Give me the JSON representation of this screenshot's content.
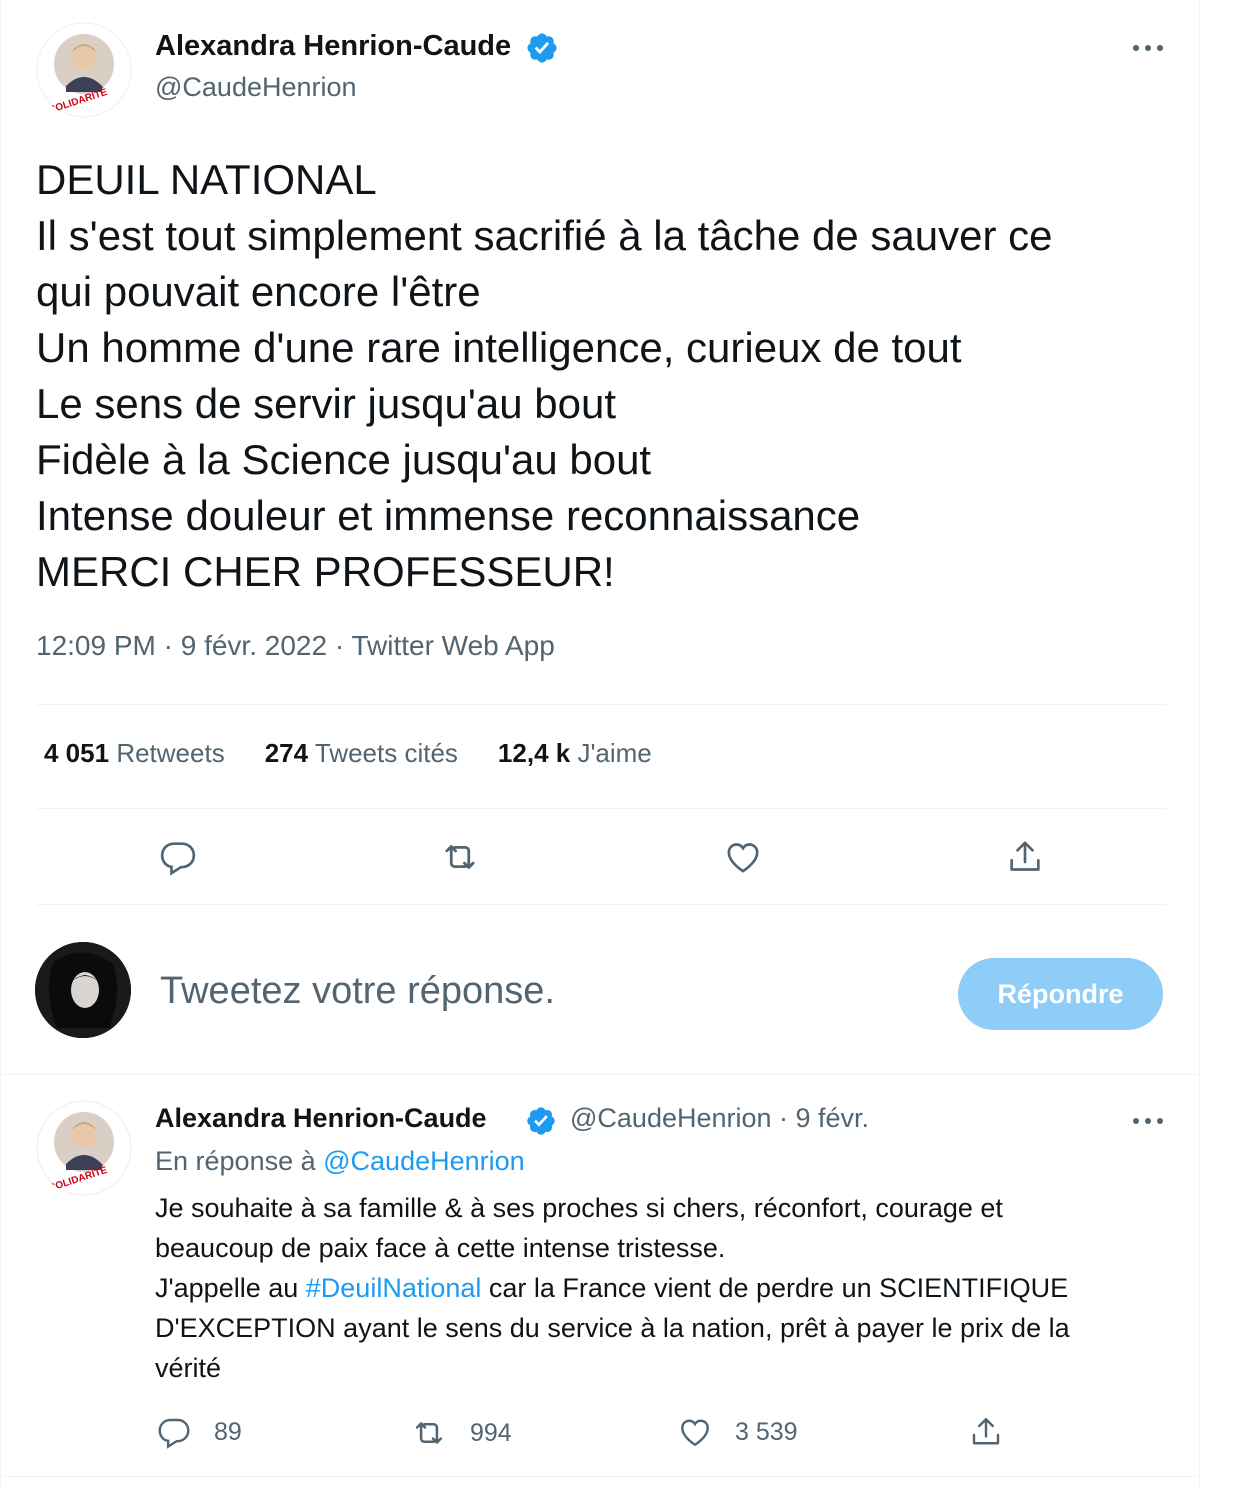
{
  "tweet": {
    "author_name": "Alexandra Henrion-Caude",
    "author_handle": "@CaudeHenrion",
    "avatar_badge_text": "SOLIDARITÉ",
    "lines": [
      "DEUIL NATIONAL",
      "Il s'est tout simplement sacrifié à la tâche de sauver ce",
      "qui pouvait encore l'être",
      "Un homme d'une rare intelligence, curieux de tout",
      "Le sens de servir jusqu'au bout",
      "Fidèle à la Science jusqu'au bout",
      "Intense douleur et immense reconnaissance",
      "MERCI CHER PROFESSEUR!"
    ],
    "timestamp": "12:09 PM · 9 févr. 2022 · Twitter Web App",
    "stats": {
      "retweets_count": "4 051",
      "retweets_label": "Retweets",
      "quotes_count": "274",
      "quotes_label": "Tweets cités",
      "likes_count": "12,4 k",
      "likes_label": "J'aime"
    }
  },
  "composer": {
    "placeholder": "Tweetez votre réponse.",
    "button_label": "Répondre"
  },
  "reply": {
    "author_name": "Alexandra Henrion-Caude",
    "handle_date": "@CaudeHenrion · 9 févr.",
    "in_reply_prefix": "En réponse à ",
    "in_reply_handle": "@CaudeHenrion",
    "line1": "Je souhaite à sa famille & à ses proches si chers, réconfort, courage et",
    "line2": "beaucoup de paix face à cette intense tristesse.",
    "line3_before": "J'appelle au ",
    "line3_hashtag": "#DeuilNational",
    "line3_after": " car la France vient de perdre un SCIENTIFIQUE",
    "line4": "D'EXCEPTION ayant le sens du service à la nation, prêt à payer le prix de la",
    "line5": "vérité",
    "reply_count": "89",
    "retweet_count": "994",
    "like_count": "3 539"
  },
  "icons": {
    "more": "more-icon",
    "verified": "verified-badge-icon",
    "reply": "reply-icon",
    "retweet": "retweet-icon",
    "like": "like-icon",
    "share": "share-icon"
  },
  "colors": {
    "accent": "#1d9bf0",
    "reply_button": "#8ecdf8",
    "secondary_text": "#536471",
    "divider": "#eff3f4"
  }
}
